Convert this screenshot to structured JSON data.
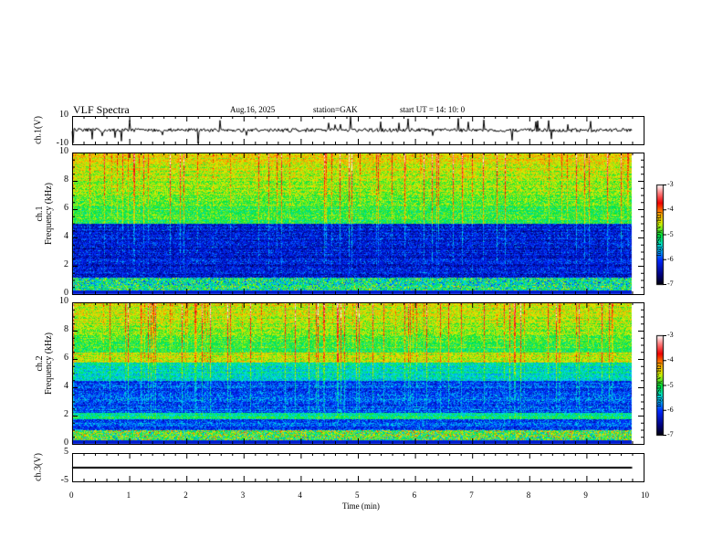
{
  "header": {
    "title": "VLF Spectra",
    "date": "Aug.16, 2025",
    "station": "station=GAK",
    "start": "start  UT =   14: 10: 0"
  },
  "chart_data": [
    {
      "type": "line",
      "ylabel": "ch.1(V)",
      "yticks": [
        "10",
        "-10"
      ],
      "ylim": [
        -10,
        10
      ],
      "description_values": {
        "baseline": 0,
        "noise_amplitude": 1,
        "spikes": "frequent impulses up to ±10 V"
      },
      "xlim": [
        0,
        10
      ],
      "data_end_min": 9.8
    },
    {
      "type": "heatmap",
      "ylabel": "ch.1\nFrequency  (kHz)",
      "ylabel_lines": [
        "ch.1",
        "Frequency  (kHz)"
      ],
      "yticks": [
        "0",
        "2",
        "4",
        "6",
        "8",
        "10"
      ],
      "ylim": [
        0,
        10
      ],
      "xlim": [
        0,
        10
      ],
      "colorbar": {
        "label": "log(PSD)(V²/Hz)",
        "ticks": [
          "-3",
          "-4",
          "-5",
          "-6",
          "-7"
        ],
        "range": [
          -7,
          -3
        ]
      }
    },
    {
      "type": "heatmap",
      "ylabel_lines": [
        "ch.2",
        "Frequency  (kHz)"
      ],
      "yticks": [
        "0",
        "2",
        "4",
        "6",
        "8",
        "10"
      ],
      "ylim": [
        0,
        10
      ],
      "xlim": [
        0,
        10
      ],
      "colorbar": {
        "label": "log(PSD)(V²/Hz)",
        "ticks": [
          "-3",
          "-4",
          "-5",
          "-6",
          "-7"
        ],
        "range": [
          -7,
          -3
        ]
      }
    },
    {
      "type": "line",
      "ylabel": "ch.3(V)",
      "yticks": [
        "5",
        "-5"
      ],
      "ylim": [
        -5,
        5
      ],
      "values_constant": -0.2,
      "xlim": [
        0,
        10
      ]
    }
  ],
  "xaxis": {
    "label": "Time  (min)",
    "ticks": [
      "0",
      "1",
      "2",
      "3",
      "4",
      "5",
      "6",
      "7",
      "8",
      "9",
      "10"
    ]
  }
}
